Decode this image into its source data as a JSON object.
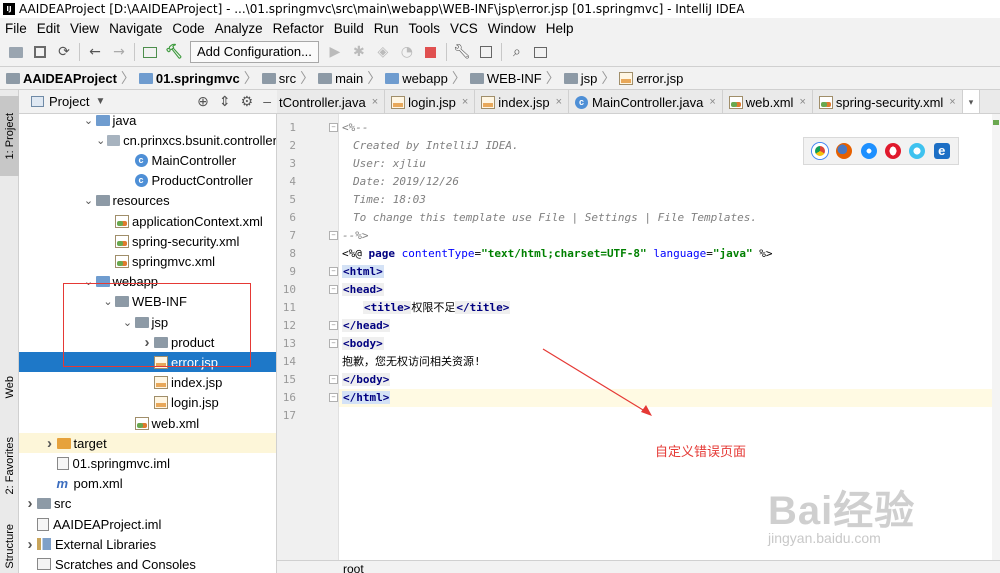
{
  "window": {
    "title": "AAIDEAProject [D:\\AAIDEAProject] - ...\\01.springmvc\\src\\main\\webapp\\WEB-INF\\jsp\\error.jsp [01.springmvc] - IntelliJ IDEA"
  },
  "menu": [
    "File",
    "Edit",
    "View",
    "Navigate",
    "Code",
    "Analyze",
    "Refactor",
    "Build",
    "Run",
    "Tools",
    "VCS",
    "Window",
    "Help"
  ],
  "toolbar": {
    "add_configuration": "Add Configuration..."
  },
  "breadcrumb": [
    "AAIDEAProject",
    "01.springmvc",
    "src",
    "main",
    "webapp",
    "WEB-INF",
    "jsp",
    "error.jsp"
  ],
  "left_stripe": {
    "project": "1: Project",
    "web": "Web",
    "favorites": "2: Favorites",
    "structure": "Structure"
  },
  "project_panel": {
    "title": "Project"
  },
  "tree": [
    {
      "label": "java",
      "indent": 3,
      "arrow": "down",
      "icon": "folder-blue"
    },
    {
      "label": "cn.prinxcs.bsunit.controller",
      "indent": 4,
      "arrow": "down",
      "icon": "package"
    },
    {
      "label": "MainController",
      "indent": 5,
      "arrow": "",
      "icon": "class"
    },
    {
      "label": "ProductController",
      "indent": 5,
      "arrow": "",
      "icon": "class"
    },
    {
      "label": "resources",
      "indent": 3,
      "arrow": "down",
      "icon": "folder"
    },
    {
      "label": "applicationContext.xml",
      "indent": 4,
      "arrow": "",
      "icon": "xml"
    },
    {
      "label": "spring-security.xml",
      "indent": 4,
      "arrow": "",
      "icon": "xml"
    },
    {
      "label": "springmvc.xml",
      "indent": 4,
      "arrow": "",
      "icon": "xml"
    },
    {
      "label": "webapp",
      "indent": 3,
      "arrow": "down",
      "icon": "folder-blue"
    },
    {
      "label": "WEB-INF",
      "indent": 4,
      "arrow": "down",
      "icon": "folder"
    },
    {
      "label": "jsp",
      "indent": 5,
      "arrow": "down",
      "icon": "folder"
    },
    {
      "label": "product",
      "indent": 6,
      "arrow": "right",
      "icon": "folder"
    },
    {
      "label": "error.jsp",
      "indent": 6,
      "arrow": "",
      "icon": "jsp",
      "selected": true
    },
    {
      "label": "index.jsp",
      "indent": 6,
      "arrow": "",
      "icon": "jsp"
    },
    {
      "label": "login.jsp",
      "indent": 6,
      "arrow": "",
      "icon": "jsp"
    },
    {
      "label": "web.xml",
      "indent": 5,
      "arrow": "",
      "icon": "xml"
    },
    {
      "label": "target",
      "indent": 1,
      "arrow": "right",
      "icon": "folder-orange",
      "highlight": true
    },
    {
      "label": "01.springmvc.iml",
      "indent": 1,
      "arrow": "",
      "icon": "iml"
    },
    {
      "label": "pom.xml",
      "indent": 1,
      "arrow": "",
      "icon": "maven"
    },
    {
      "label": "src",
      "indent": 0,
      "arrow": "right",
      "icon": "folder"
    },
    {
      "label": "AAIDEAProject.iml",
      "indent": 0,
      "arrow": "",
      "icon": "iml"
    },
    {
      "label": "External Libraries",
      "indent": 0,
      "arrow": "right",
      "icon": "library"
    },
    {
      "label": "Scratches and Consoles",
      "indent": 0,
      "arrow": "",
      "icon": "scratch"
    }
  ],
  "tabs": [
    {
      "label": "tController.java",
      "icon": "class"
    },
    {
      "label": "login.jsp",
      "icon": "jsp"
    },
    {
      "label": "index.jsp",
      "icon": "jsp"
    },
    {
      "label": "MainController.java",
      "icon": "class"
    },
    {
      "label": "web.xml",
      "icon": "xml"
    },
    {
      "label": "spring-security.xml",
      "icon": "xml"
    }
  ],
  "editor": {
    "line_numbers": [
      "1",
      "2",
      "3",
      "4",
      "5",
      "6",
      "7",
      "8",
      "9",
      "10",
      "11",
      "12",
      "13",
      "14",
      "15",
      "16",
      "17"
    ],
    "lines": {
      "l1": "<%--",
      "l2": "Created by IntelliJ IDEA.",
      "l3": "User: xjliu",
      "l4": "Date: 2019/12/26",
      "l5": "Time: 18:03",
      "l6": "To change this template use File | Settings | File Templates.",
      "l7": "--%>",
      "l8_open": "<%@ ",
      "l8_page": "page",
      "l8_ct_attr": "contentType",
      "l8_ct_val": "\"text/html;charset=UTF-8\"",
      "l8_lang_attr": "language",
      "l8_lang_val": "\"java\"",
      "l8_close": " %>",
      "l9_tag": "<html>",
      "l10_tag": "<head>",
      "l11_open": "<title>",
      "l11_text": "权限不足",
      "l11_close": "</title>",
      "l12_tag": "</head>",
      "l13_tag": "<body>",
      "l14_text": "抱歉，您无权访问相关资源!",
      "l15_tag": "</body>",
      "l16_tag": "</html>"
    }
  },
  "status": {
    "path": "root"
  },
  "annotation": {
    "text": "自定义错误页面",
    "color": "#e53935"
  },
  "watermark": {
    "main": "Bai经验",
    "sub": "jingyan.baidu.com"
  },
  "colors": {
    "selection": "#1e78c8",
    "annotation_red": "#e53935"
  }
}
